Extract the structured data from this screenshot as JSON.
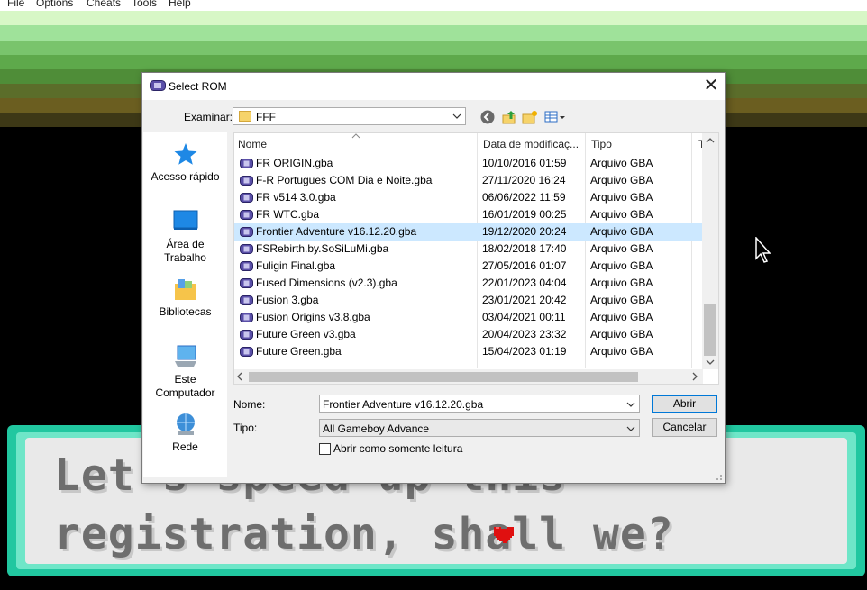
{
  "menubar": {
    "items": [
      "File",
      "Options",
      "Cheats",
      "Tools",
      "Help"
    ]
  },
  "game": {
    "line1": "Let's speed up this",
    "line2": "registration, shall we?"
  },
  "dialog": {
    "title": "Select ROM",
    "lookin_label": "Examinar:",
    "lookin_value": "FFF",
    "places": [
      "Acesso rápido",
      "Área de Trabalho",
      "Bibliotecas",
      "Este Computador",
      "Rede"
    ],
    "columns": {
      "name": "Nome",
      "date": "Data de modificaç...",
      "type": "Tipo",
      "extra": "T"
    },
    "files": [
      {
        "name": "FR ORIGIN.gba",
        "date": "10/10/2016 01:59",
        "type": "Arquivo GBA"
      },
      {
        "name": "F-R Portugues COM Dia e Noite.gba",
        "date": "27/11/2020 16:24",
        "type": "Arquivo GBA"
      },
      {
        "name": "FR v514 3.0.gba",
        "date": "06/06/2022 11:59",
        "type": "Arquivo GBA"
      },
      {
        "name": "FR WTC.gba",
        "date": "16/01/2019 00:25",
        "type": "Arquivo GBA"
      },
      {
        "name": "Frontier Adventure v16.12.20.gba",
        "date": "19/12/2020 20:24",
        "type": "Arquivo GBA",
        "selected": true
      },
      {
        "name": "FSRebirth.by.SoSiLuMi.gba",
        "date": "18/02/2018 17:40",
        "type": "Arquivo GBA"
      },
      {
        "name": "Fuligin Final.gba",
        "date": "27/05/2016 01:07",
        "type": "Arquivo GBA"
      },
      {
        "name": "Fused Dimensions (v2.3).gba",
        "date": "22/01/2023 04:04",
        "type": "Arquivo GBA"
      },
      {
        "name": "Fusion 3.gba",
        "date": "23/01/2021 20:42",
        "type": "Arquivo GBA"
      },
      {
        "name": "Fusion Origins v3.8.gba",
        "date": "03/04/2021 00:11",
        "type": "Arquivo GBA"
      },
      {
        "name": "Future Green v3.gba",
        "date": "20/04/2023 23:32",
        "type": "Arquivo GBA"
      },
      {
        "name": "Future Green.gba",
        "date": "15/04/2023 01:19",
        "type": "Arquivo GBA"
      }
    ],
    "filename_label": "Nome:",
    "filename_value": "Frontier Adventure v16.12.20.gba",
    "filetype_label": "Tipo:",
    "filetype_value": "All Gameboy Advance",
    "readonly_label": "Abrir como somente leitura",
    "open_label": "Abrir",
    "cancel_label": "Cancelar"
  },
  "colors": {
    "selection": "#cce8ff",
    "accent": "#0078d7",
    "textbox_teal": "#21c7a0"
  }
}
